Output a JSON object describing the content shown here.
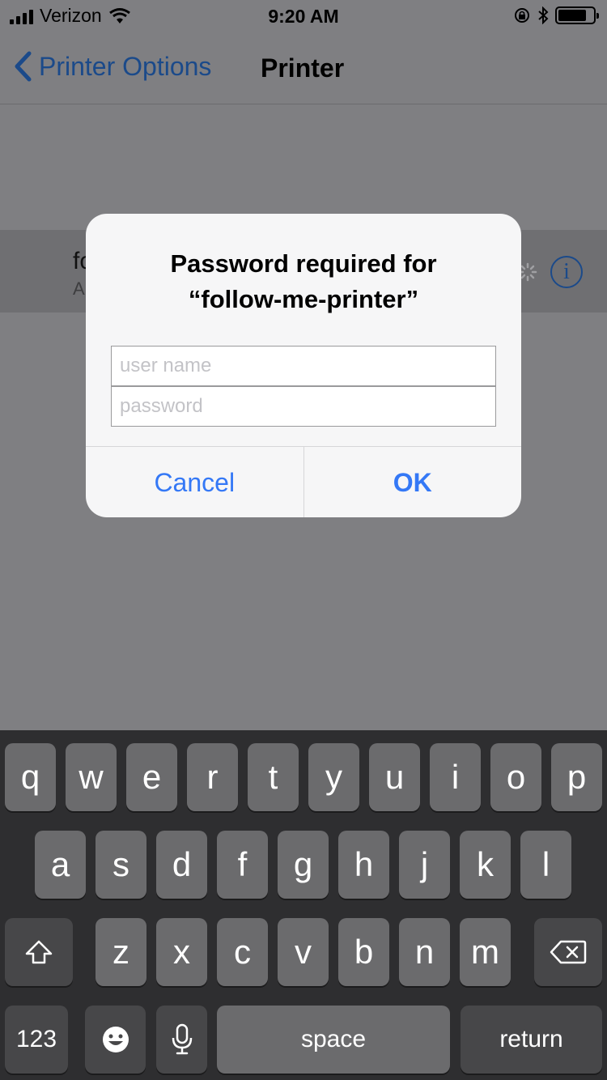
{
  "status_bar": {
    "carrier": "Verizon",
    "time": "9:20 AM",
    "icons": [
      "signal-icon",
      "wifi-icon",
      "rotation-lock-icon",
      "bluetooth-icon",
      "battery-icon"
    ],
    "battery_level": 0.8
  },
  "nav": {
    "back_label": "Printer Options",
    "title": "Printer"
  },
  "printer_row": {
    "name": "fo",
    "subtitle": "A"
  },
  "alert": {
    "title_line1": "Password required for",
    "title_line2": "“follow-me-printer”",
    "username_placeholder": "user name",
    "password_placeholder": "password",
    "cancel_label": "Cancel",
    "ok_label": "OK"
  },
  "keyboard": {
    "row1": [
      "q",
      "w",
      "e",
      "r",
      "t",
      "y",
      "u",
      "i",
      "o",
      "p"
    ],
    "row2": [
      "a",
      "s",
      "d",
      "f",
      "g",
      "h",
      "j",
      "k",
      "l"
    ],
    "row3": [
      "z",
      "x",
      "c",
      "v",
      "b",
      "n",
      "m"
    ],
    "numbers_label": "123",
    "space_label": "space",
    "return_label": "return"
  },
  "colors": {
    "accent": "#3478f6",
    "nav_tint": "#1b4a8a",
    "keyboard_bg": "#2e2e30",
    "key_bg": "#6b6b6d"
  }
}
